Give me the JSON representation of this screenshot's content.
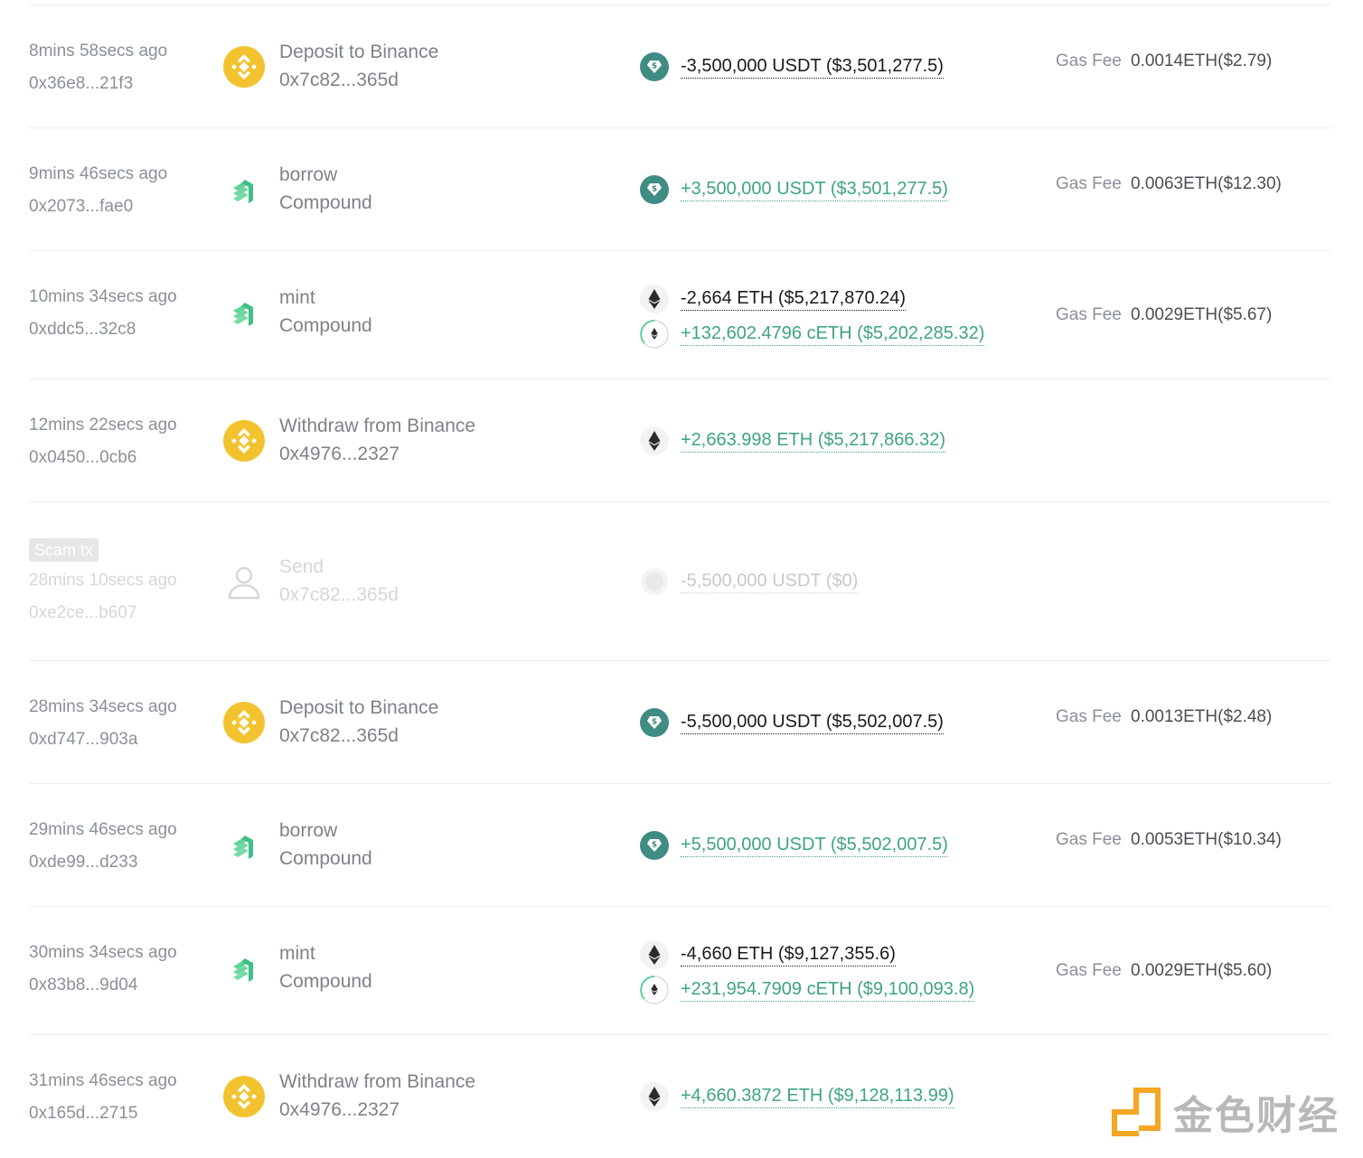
{
  "gas_label": "Gas Fee",
  "scam_tag": "Scam tx",
  "watermark_text": "金色财经",
  "transactions": [
    {
      "time": "8mins 58secs ago",
      "hash": "0x36e8...21f3",
      "protocol_icon": "binance-icon",
      "action": "Deposit to Binance",
      "sub": "0x7c82...365d",
      "amounts": [
        {
          "token": "usdt-icon",
          "text": "-3,500,000 USDT ($3,501,277.5)",
          "sign": "neg"
        }
      ],
      "gas": "0.0014ETH($2.79)"
    },
    {
      "time": "9mins 46secs ago",
      "hash": "0x2073...fae0",
      "protocol_icon": "compound-icon",
      "action": "borrow",
      "sub": "Compound",
      "amounts": [
        {
          "token": "usdt-icon",
          "text": "+3,500,000 USDT ($3,501,277.5)",
          "sign": "pos"
        }
      ],
      "gas": "0.0063ETH($12.30)"
    },
    {
      "time": "10mins 34secs ago",
      "hash": "0xddc5...32c8",
      "protocol_icon": "compound-icon",
      "action": "mint",
      "sub": "Compound",
      "amounts": [
        {
          "token": "eth-icon",
          "text": "-2,664 ETH ($5,217,870.24)",
          "sign": "neg"
        },
        {
          "token": "ceth-icon",
          "text": "+132,602.4796 cETH ($5,202,285.32)",
          "sign": "pos"
        }
      ],
      "gas": "0.0029ETH($5.67)"
    },
    {
      "time": "12mins 22secs ago",
      "hash": "0x0450...0cb6",
      "protocol_icon": "binance-icon",
      "action": "Withdraw from Binance",
      "sub": "0x4976...2327",
      "amounts": [
        {
          "token": "eth-icon",
          "text": "+2,663.998 ETH ($5,217,866.32)",
          "sign": "pos"
        }
      ],
      "gas": ""
    },
    {
      "time": "28mins 10secs ago",
      "hash": "0xe2ce...b607",
      "protocol_icon": "user-icon",
      "action": "Send",
      "sub": "0x7c82...365d",
      "scam": true,
      "amounts": [
        {
          "token": "unknown-token-icon",
          "text": "-5,500,000 USDT ($0)",
          "sign": "faded"
        }
      ],
      "gas": ""
    },
    {
      "time": "28mins 34secs ago",
      "hash": "0xd747...903a",
      "protocol_icon": "binance-icon",
      "action": "Deposit to Binance",
      "sub": "0x7c82...365d",
      "amounts": [
        {
          "token": "usdt-icon",
          "text": "-5,500,000 USDT ($5,502,007.5)",
          "sign": "neg"
        }
      ],
      "gas": "0.0013ETH($2.48)"
    },
    {
      "time": "29mins 46secs ago",
      "hash": "0xde99...d233",
      "protocol_icon": "compound-icon",
      "action": "borrow",
      "sub": "Compound",
      "amounts": [
        {
          "token": "usdt-icon",
          "text": "+5,500,000 USDT ($5,502,007.5)",
          "sign": "pos"
        }
      ],
      "gas": "0.0053ETH($10.34)"
    },
    {
      "time": "30mins 34secs ago",
      "hash": "0x83b8...9d04",
      "protocol_icon": "compound-icon",
      "action": "mint",
      "sub": "Compound",
      "amounts": [
        {
          "token": "eth-icon",
          "text": "-4,660 ETH ($9,127,355.6)",
          "sign": "neg"
        },
        {
          "token": "ceth-icon",
          "text": "+231,954.7909 cETH ($9,100,093.8)",
          "sign": "pos"
        }
      ],
      "gas": "0.0029ETH($5.60)"
    },
    {
      "time": "31mins 46secs ago",
      "hash": "0x165d...2715",
      "protocol_icon": "binance-icon",
      "action": "Withdraw from Binance",
      "sub": "0x4976...2327",
      "amounts": [
        {
          "token": "eth-icon",
          "text": "+4,660.3872 ETH ($9,128,113.99)",
          "sign": "pos"
        }
      ],
      "gas": ""
    }
  ]
}
